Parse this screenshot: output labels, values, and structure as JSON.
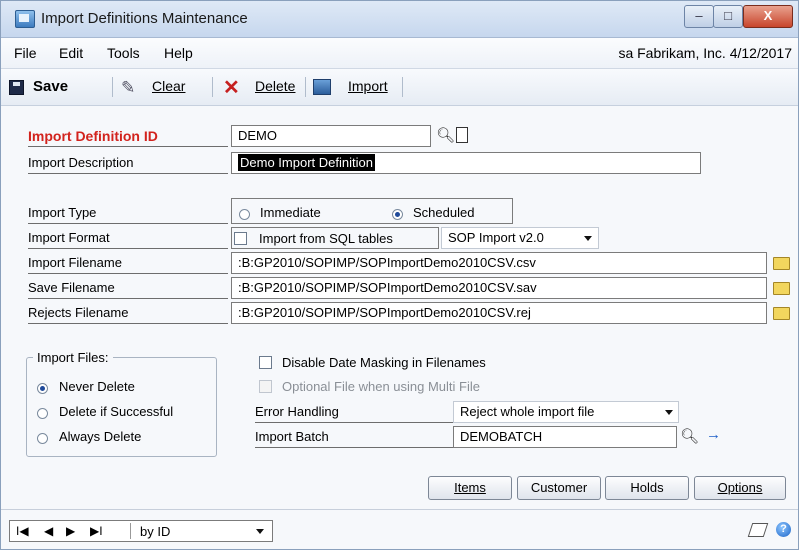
{
  "window": {
    "title": "Import Definitions Maintenance",
    "minimize_glyph": "–",
    "maximize_glyph": "□",
    "close_glyph": "X"
  },
  "menu": {
    "items": [
      "File",
      "Edit",
      "Tools",
      "Help"
    ],
    "company_info": "sa  Fabrikam, Inc.  4/12/2017"
  },
  "toolbar": {
    "save_label": "Save",
    "clear_label": "Clear",
    "delete_label": "Delete",
    "import_label": "Import"
  },
  "form": {
    "import_definition_id": {
      "label": "Import Definition ID",
      "value": "DEMO"
    },
    "import_description": {
      "label": "Import Description",
      "value": "Demo Import Definition"
    },
    "import_type": {
      "label": "Import Type",
      "options": [
        "Immediate",
        "Scheduled"
      ],
      "selected": "Scheduled"
    },
    "import_format": {
      "label": "Import Format",
      "checkbox_label": "Import from SQL tables",
      "checked": false,
      "selected_format": "SOP Import v2.0"
    },
    "import_filename": {
      "label": "Import Filename",
      "value": ":B:GP2010/SOPIMP/SOPImportDemo2010CSV.csv"
    },
    "save_filename": {
      "label": "Save Filename",
      "value": ":B:GP2010/SOPIMP/SOPImportDemo2010CSV.sav"
    },
    "rejects_filename": {
      "label": "Rejects Filename",
      "value": ":B:GP2010/SOPIMP/SOPImportDemo2010CSV.rej"
    },
    "import_files": {
      "title": "Import Files:",
      "options": [
        "Never Delete",
        "Delete if Successful",
        "Always Delete"
      ],
      "selected": "Never Delete"
    },
    "disable_date_masking": {
      "label": "Disable Date Masking in Filenames",
      "checked": false
    },
    "optional_file": {
      "label": "Optional File when using Multi File",
      "checked": false,
      "disabled": true
    },
    "error_handling": {
      "label": "Error Handling",
      "value": "Reject whole import file"
    },
    "import_batch": {
      "label": "Import Batch",
      "value": "DEMOBATCH"
    }
  },
  "buttons": {
    "items_label": "Items",
    "customer_label": "Customer",
    "holds_label": "Holds",
    "options_label": "Options"
  },
  "statusbar": {
    "first_glyph": "I◀",
    "prev_glyph": "◀",
    "next_glyph": "▶",
    "last_glyph": "▶I",
    "sort_value": "by ID"
  },
  "icons": {
    "folder": "folder-icon",
    "lookup": "lookup-icon",
    "note": "note-icon",
    "help": "help-icon",
    "help_glyph": "?"
  },
  "colors": {
    "required_label": "#d2231d",
    "accent_blue": "#1f4a9a"
  }
}
